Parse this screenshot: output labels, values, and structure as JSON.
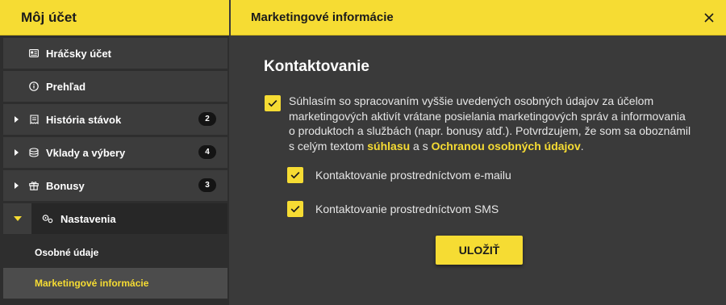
{
  "sidebar": {
    "title": "Môj účet",
    "items": [
      {
        "label": "Hráčsky účet"
      },
      {
        "label": "Prehľad"
      },
      {
        "label": "História stávok",
        "badge": "2"
      },
      {
        "label": "Vklady a výbery",
        "badge": "4"
      },
      {
        "label": "Bonusy",
        "badge": "3"
      },
      {
        "label": "Nastavenia"
      }
    ],
    "subitems": [
      {
        "label": "Osobné údaje"
      },
      {
        "label": "Marketingové informácie"
      }
    ]
  },
  "main": {
    "title": "Marketingové informácie",
    "section_title": "Kontaktovanie",
    "consent": {
      "checked": true,
      "text_before": "Súhlasím so spracovaním vyššie uvedených osobných údajov za účelom marketingových aktivít vrátane posielania marketingových správ a informovania o produktoch a službách (napr. bonusy atď.). Potvrdzujem, že som sa oboznámil s celým textom ",
      "link1": "súhlasu",
      "text_middle": " a s ",
      "link2": "Ochranou osobných údajov",
      "text_after": "."
    },
    "options": [
      {
        "label": "Kontaktovanie prostredníctvom e-mailu",
        "checked": true
      },
      {
        "label": "Kontaktovanie prostredníctvom SMS",
        "checked": true
      }
    ],
    "save_label": "ULOŽIŤ"
  },
  "colors": {
    "accent": "#f6dc33",
    "panel_bg": "#3a3a3a",
    "sidebar_bg": "#2e2e2e",
    "row_bg": "#3c3c3c",
    "badge_bg": "#141414"
  }
}
